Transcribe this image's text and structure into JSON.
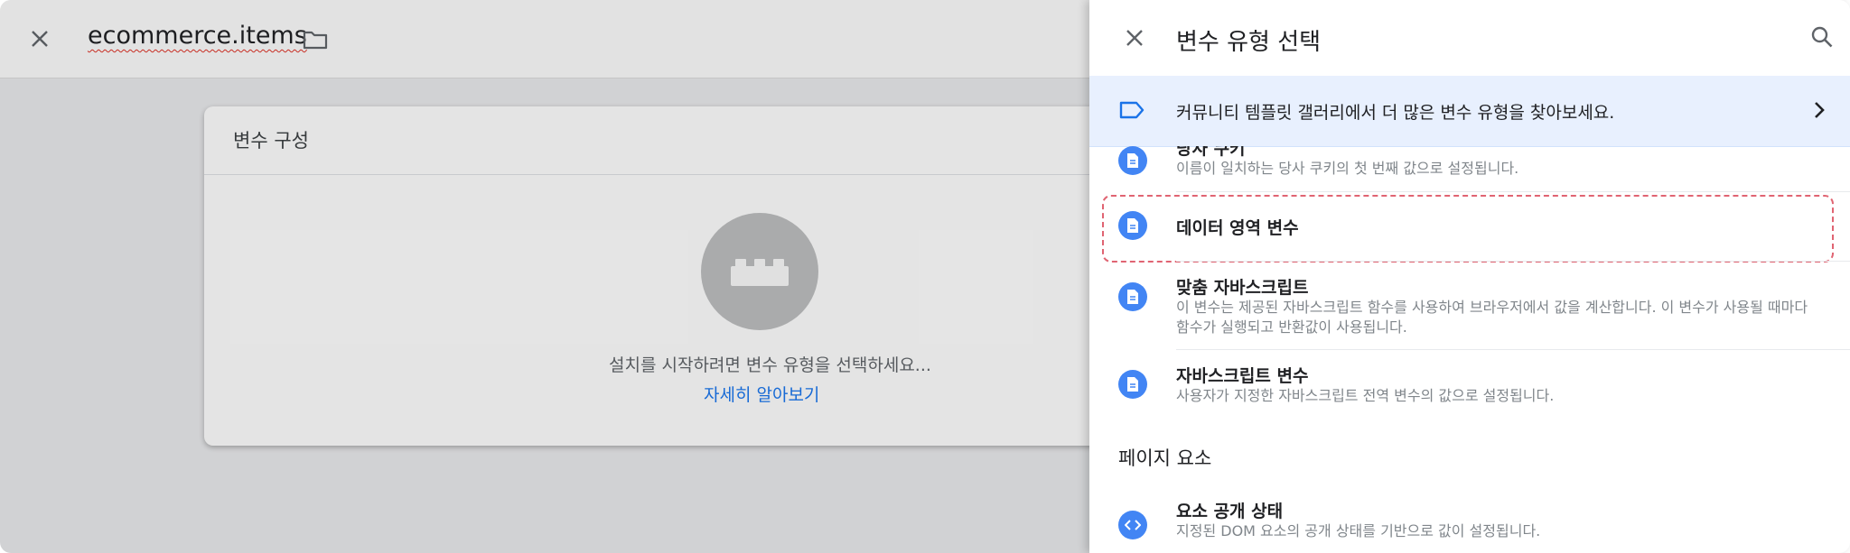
{
  "editor": {
    "title": "ecommerce.items",
    "card_title": "변수 구성",
    "message": "설치를 시작하려면 변수 유형을 선택하세요...",
    "learn_more": "자세히 알아보기"
  },
  "panel": {
    "title": "변수 유형 선택",
    "banner_text": "커뮤니티 템플릿 갤러리에서 더 많은 변수 유형을 찾아보세요.",
    "items": [
      {
        "title": "당사 쿠키",
        "desc": "이름이 일치하는 당사 쿠키의 첫 번째 값으로 설정됩니다."
      },
      {
        "title": "데이터 영역 변수",
        "desc": ""
      },
      {
        "title": "맞춤 자바스크립트",
        "desc": "이 변수는 제공된 자바스크립트 함수를 사용하여 브라우저에서 값을 계산합니다. 이 변수가 사용될 때마다 함수가 실행되고 반환값이 사용됩니다."
      },
      {
        "title": "자바스크립트 변수",
        "desc": "사용자가 지정한 자바스크립트 전역 변수의 값으로 설정됩니다."
      }
    ],
    "section_title": "페이지 요소",
    "section_items": [
      {
        "title": "요소 공개 상태",
        "desc": "지정된 DOM 요소의 공개 상태를 기반으로 값이 설정됩니다."
      }
    ]
  },
  "colors": {
    "accent": "#1a73e8",
    "icon_blue": "#4285f4",
    "banner_bg": "#e8f0fe",
    "highlight": "#e06472"
  },
  "icons": [
    "close-icon",
    "folder-icon",
    "lego-brick-icon",
    "search-icon",
    "tag-icon",
    "chevron-right-icon",
    "document-icon",
    "code-icon"
  ]
}
